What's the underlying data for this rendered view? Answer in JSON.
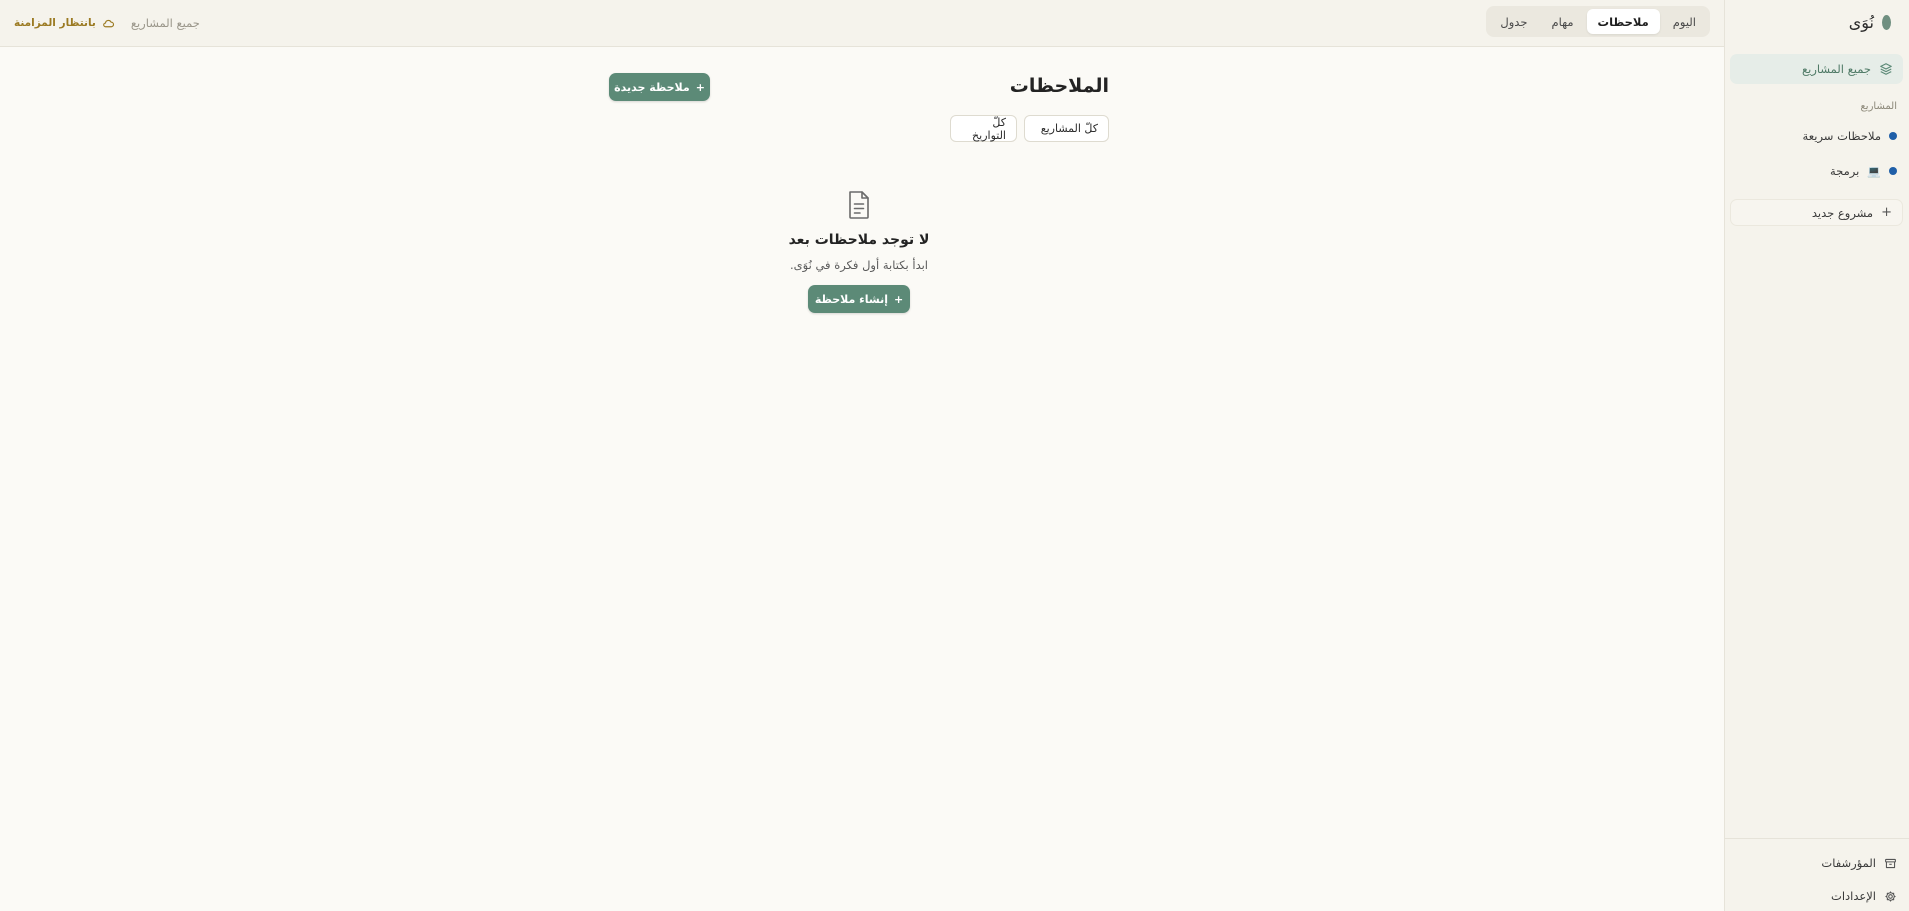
{
  "app": {
    "name": "نُوَى"
  },
  "colors": {
    "accent": "#5c8a77",
    "sync": "#9b7a22",
    "project_dot": "#1f5fa8"
  },
  "sidebar": {
    "all_projects": "جميع المشاريع",
    "section_label": "المشاريع",
    "projects": [
      {
        "label": "ملاحظات سريعة",
        "emoji": ""
      },
      {
        "label": "برمجة",
        "emoji": "💻"
      }
    ],
    "new_project": "مشروع جديد",
    "footer": {
      "archive": "المؤرشفات",
      "settings": "الإعدادات"
    }
  },
  "topbar": {
    "tabs": [
      {
        "label": "اليوم",
        "active": false
      },
      {
        "label": "ملاحظات",
        "active": true
      },
      {
        "label": "مهام",
        "active": false
      },
      {
        "label": "جدول",
        "active": false
      }
    ],
    "breadcrumb": "جميع المشاريع",
    "sync_status": "بانتظار المزامنة"
  },
  "main": {
    "title": "الملاحظات",
    "new_note_button": "ملاحظة جديدة",
    "filters": {
      "projects": "كلّ المشاريع",
      "dates": "كلّ التواريخ"
    },
    "empty_state": {
      "title": "لا توجد ملاحظات بعد",
      "subtitle": "ابدأ بكتابة أول فكرة في نُوَى.",
      "button": "إنشاء ملاحظة"
    }
  }
}
